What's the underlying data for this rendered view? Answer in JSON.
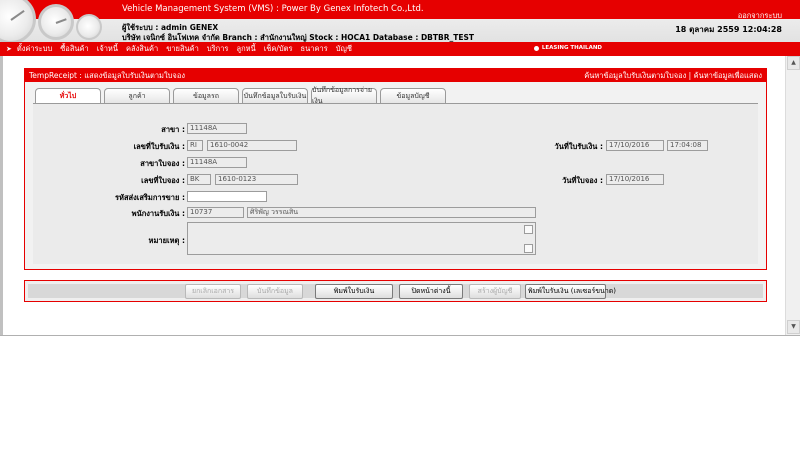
{
  "header": {
    "app_title": "Vehicle Management System (VMS)  : Power By Genex Infotech Co.,Ltd.",
    "logout_label": "ออกจากระบบ",
    "user_line": "ผู้ใช้ระบบ : admin GENEX",
    "company_line": "บริษัท เจนิกซ์ อินโฟเทค จำกัด Branch : สำนักงานใหญ่ Stock : HOCA1 Database : DBTBR_TEST",
    "datetime": "18 ตุลาคม 2559 12:04:28"
  },
  "menu": {
    "items": [
      "ตั้งค่าระบบ",
      "ซื้อสินค้า",
      "เจ้าหนี้",
      "คลังสินค้า",
      "ขายสินค้า",
      "บริการ",
      "ลูกหนี้",
      "เช็ค/บัตร",
      "ธนาคาร",
      "บัญชี"
    ],
    "leasing_label": "LEASING THAILAND"
  },
  "panel": {
    "title": "TempReceipt : แสดงข้อมูลใบรับเงินตามใบจอง",
    "link_search_receipt": "ค้นหาข้อมูลใบรับเงินตามใบจอง",
    "link_separator": " | ",
    "link_search_display": "ค้นหาข้อมูลเพื่อแสดง"
  },
  "tabs": [
    {
      "label": "ทั่วไป",
      "active": true
    },
    {
      "label": "ลูกค้า",
      "active": false
    },
    {
      "label": "ข้อมูลรถ",
      "active": false
    },
    {
      "label": "บันทึกข้อมูลใบรับเงิน",
      "active": false
    },
    {
      "label": "บันทึกข้อมูลการจ่ายเงิน",
      "active": false
    },
    {
      "label": "ข้อมูลบัญชี",
      "active": false
    }
  ],
  "form": {
    "branch_label": "สาขา :",
    "branch_value": "11148A",
    "receipt_no_label": "เลขที่ใบรับเงิน :",
    "receipt_prefix": "RI",
    "receipt_no": "1610-0042",
    "receipt_date_label": "วันที่ใบรับเงิน :",
    "receipt_date": "17/10/2016",
    "receipt_time": "17:04:08",
    "booking_branch_label": "สาขาใบจอง :",
    "booking_branch_value": "11148A",
    "booking_no_label": "เลขที่ใบจอง :",
    "booking_prefix": "BK",
    "booking_no": "1610-0123",
    "booking_date_label": "วันที่ใบจอง :",
    "booking_date": "17/10/2016",
    "promo_code_label": "รหัสส่งเสริมการขาย :",
    "promo_code_value": "",
    "staff_label": "พนักงานรับเงิน :",
    "staff_code": "10737",
    "staff_name": "ศิริพัญ วรรณสิน",
    "remark_label": "หมายเหตุ :",
    "remark_value": ""
  },
  "buttons": {
    "cancel_doc": "ยกเลิกเอกสาร",
    "save": "บันทึกข้อมูล",
    "print_receipt": "พิมพ์ใบรับเงิน",
    "close_window": "ปิดหน้าต่างนี้",
    "create_account": "สร้างผู้บัญชี",
    "print_receipt_laser": "พิมพ์ใบรับเงิน (เลเซอร์ขนาด)"
  },
  "colors": {
    "brand_red": "#e60000",
    "panel_bg": "#f2f2f2",
    "field_bg": "#ececec"
  }
}
